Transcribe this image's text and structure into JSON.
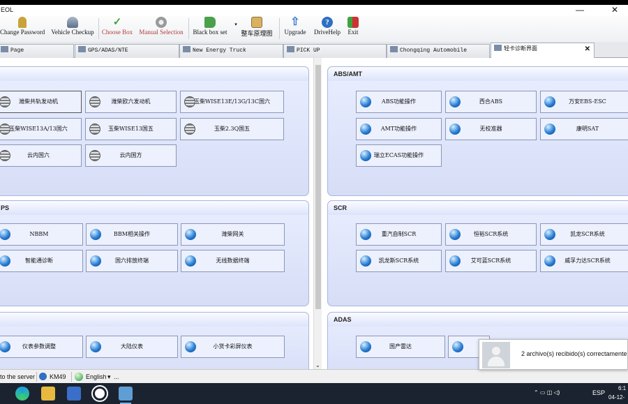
{
  "window": {
    "title": "EOL",
    "minimize_symbol": "—",
    "close_symbol": "✕"
  },
  "toolbar": [
    {
      "label": "Change Password",
      "icon": "key-icon",
      "color": "#c9a23a"
    },
    {
      "label": "Vehicle Checkup",
      "icon": "car-icon",
      "color": "#5d6f8d"
    },
    {
      "label": "Choose Box",
      "icon": "check-icon",
      "color": "#3ea33e"
    },
    {
      "label": "Manual Selection",
      "icon": "gear-icon",
      "color": "#9a9a9a"
    },
    {
      "label": "Black box set",
      "icon": "flag-icon",
      "color": "#4aa14a"
    },
    {
      "label": "整车原理图",
      "icon": "diagram-icon",
      "color": "#d9b25f"
    },
    {
      "label": "Upgrade",
      "icon": "upload-icon",
      "color": "#3a7fd0"
    },
    {
      "label": "DriveHelp",
      "icon": "help-icon",
      "color": "#2f6fc4"
    },
    {
      "label": "Exit",
      "icon": "exit-icon",
      "color": "#cc3333"
    }
  ],
  "tabs": [
    {
      "label": "Page"
    },
    {
      "label": "GPS/ADAS/NTE"
    },
    {
      "label": "New Energy Truck"
    },
    {
      "label": "PICK UP"
    },
    {
      "label": "Chongqing Automobile"
    },
    {
      "label": "轻卡诊断界面",
      "active": true,
      "close": "✕"
    }
  ],
  "panels": {
    "engine": {
      "title": "",
      "buttons": [
        "潍柴共轨发动机",
        "潍柴欧六发动机",
        "玉柴WISE13E/13G/13C国六",
        "玉柴WISE13A/13国六",
        "玉柴WISE13国五",
        "玉柴2.3Q国五",
        "云内国六",
        "云内国方"
      ]
    },
    "abs": {
      "title": "ABS/AMT",
      "buttons": [
        "ABS功能操作",
        "西合ABS",
        "万安EBS-ESC",
        "AMT功能操作",
        "无校准器",
        "康明SAT",
        "瑞立ECAS功能操作"
      ]
    },
    "ps": {
      "title": "PS",
      "buttons": [
        "NBBM",
        "BBM相关操作",
        "潍柴网关",
        "智能通诊断",
        "国六排放终端",
        "无线数据终端"
      ]
    },
    "scr": {
      "title": "SCR",
      "buttons": [
        "重汽自制SCR",
        "恒裕SCR系统",
        "凯龙SCR系统",
        "凯龙斯SCR系统",
        "艾可蓝SCR系统",
        "威孚力达SCR系统"
      ]
    },
    "bottom": {
      "title": "",
      "buttons": [
        "仪表参数调整",
        "大陆仪表",
        "小货卡彩屏仪表"
      ]
    },
    "adas": {
      "title": "ADAS",
      "buttons": [
        "国产雷达",
        ""
      ]
    }
  },
  "scrollbar": {
    "down_arrow": "⌄"
  },
  "statusbar": {
    "server": "to the server",
    "device": "KM49",
    "language": "English",
    "dropdown_symbol": "▾",
    "more": "..."
  },
  "notification": {
    "message": "2 archivo(s) recibido(s) correctamente"
  },
  "taskbar": {
    "language": "ESP",
    "time": "6:1",
    "date": "04-12-"
  }
}
